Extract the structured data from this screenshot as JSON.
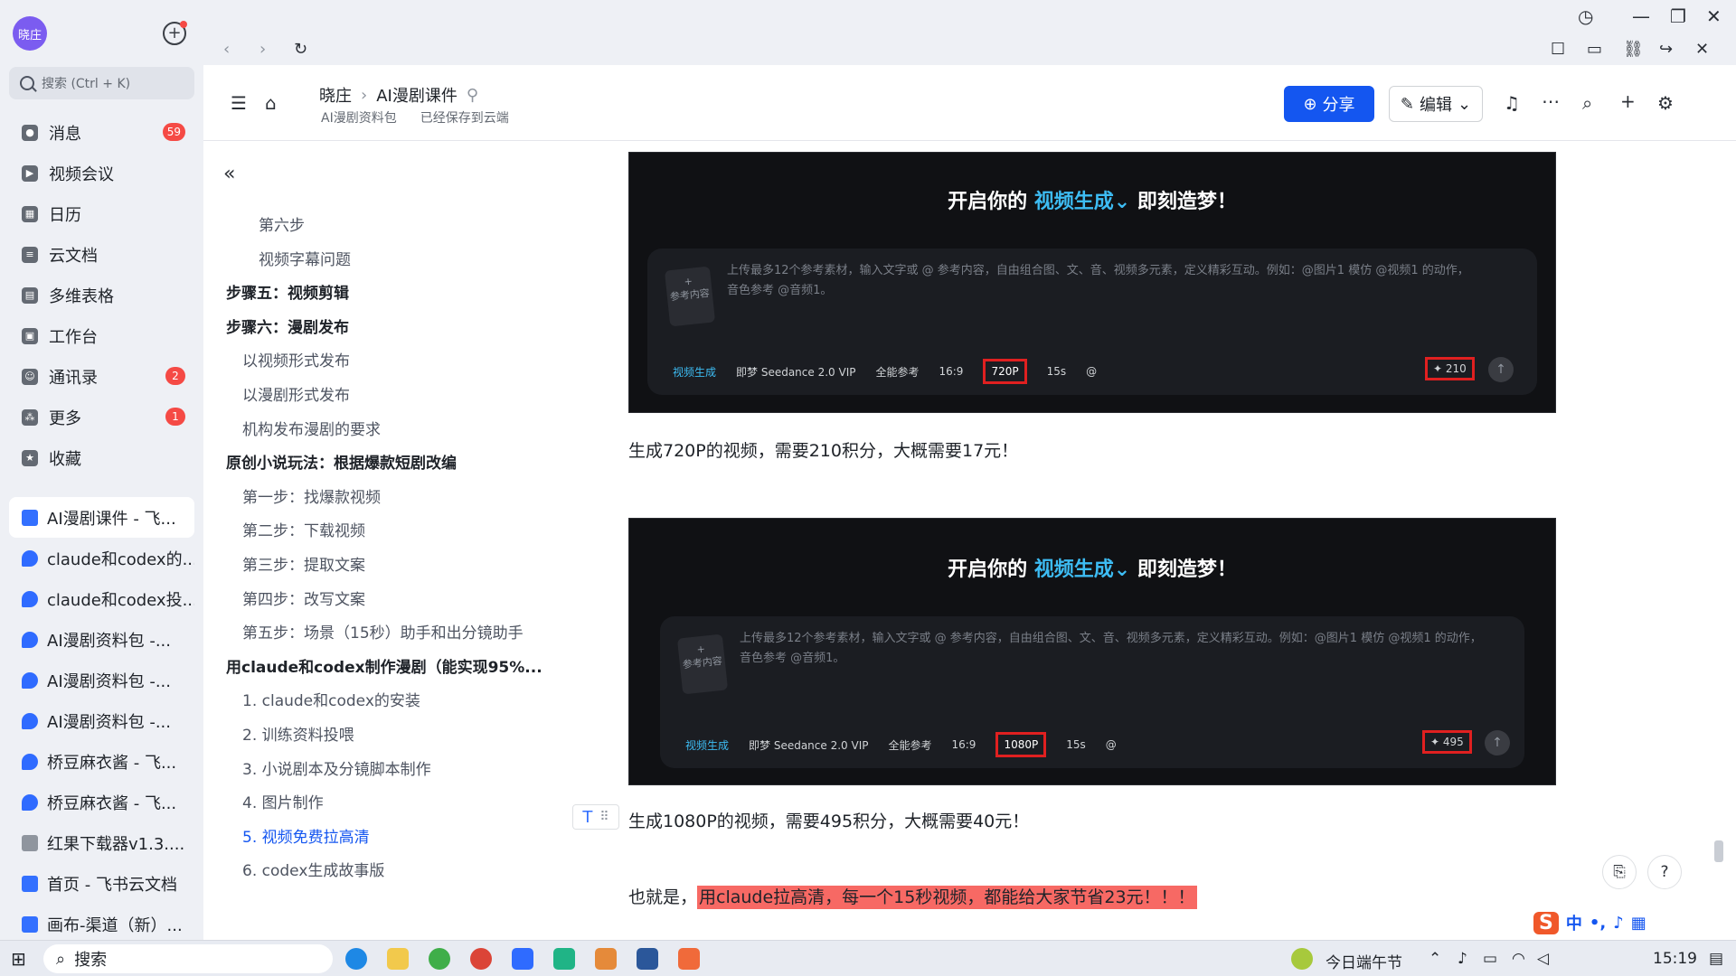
{
  "sidebar": {
    "avatar": "晓庄",
    "search_placeholder": "搜索 (Ctrl + K)",
    "nav": [
      {
        "label": "消息",
        "badge": "59"
      },
      {
        "label": "视频会议",
        "badge": ""
      },
      {
        "label": "日历",
        "badge": ""
      },
      {
        "label": "云文档",
        "badge": ""
      },
      {
        "label": "多维表格",
        "badge": ""
      },
      {
        "label": "工作台",
        "badge": ""
      },
      {
        "label": "通讯录",
        "badge": "2"
      },
      {
        "label": "更多",
        "badge": "1"
      },
      {
        "label": "收藏",
        "badge": ""
      }
    ],
    "recent": [
      {
        "label": "AI漫剧课件 - 飞...",
        "icon": "doc"
      },
      {
        "label": "claude和codex的...",
        "icon": "bird"
      },
      {
        "label": "claude和codex投...",
        "icon": "bird"
      },
      {
        "label": "AI漫剧资料包 -...",
        "icon": "bird"
      },
      {
        "label": "AI漫剧资料包 -...",
        "icon": "bird"
      },
      {
        "label": "AI漫剧资料包 -...",
        "icon": "bird"
      },
      {
        "label": "桥豆麻衣酱 - 飞...",
        "icon": "bird"
      },
      {
        "label": "桥豆麻衣酱 - 飞...",
        "icon": "bird"
      },
      {
        "label": "红果下载器v1.3....",
        "icon": "file"
      },
      {
        "label": "首页 - 飞书云文档",
        "icon": "doc"
      },
      {
        "label": "画布-渠道（新）...",
        "icon": "doc"
      }
    ]
  },
  "header": {
    "crumb_root": "晓庄",
    "crumb_doc": "AI漫剧课件",
    "sub_folder": "AI漫剧资料包",
    "save_status": "已经保存到云端",
    "share": "分享",
    "edit": "编辑"
  },
  "toc": {
    "items": [
      {
        "label": "第六步",
        "level": 2
      },
      {
        "label": "视频字幕问题",
        "level": 2
      },
      {
        "label": "步骤五：视频剪辑",
        "level": 0
      },
      {
        "label": "步骤六：漫剧发布",
        "level": 0
      },
      {
        "label": "以视频形式发布",
        "level": 1
      },
      {
        "label": "以漫剧形式发布",
        "level": 1
      },
      {
        "label": "机构发布漫剧的要求",
        "level": 1
      },
      {
        "label": "原创小说玩法：根据爆款短剧改编",
        "level": 0
      },
      {
        "label": "第一步：找爆款视频",
        "level": 1
      },
      {
        "label": "第二步：下载视频",
        "level": 1
      },
      {
        "label": "第三步：提取文案",
        "level": 1
      },
      {
        "label": "第四步：改写文案",
        "level": 1
      },
      {
        "label": "第五步：场景（15秒）助手和出分镜助手",
        "level": 1
      },
      {
        "label": "用claude和codex制作漫剧（能实现95%...",
        "level": 0
      },
      {
        "label": "1. claude和codex的安装",
        "level": 1
      },
      {
        "label": "2. 训练资料投喂",
        "level": 1
      },
      {
        "label": "3. 小说剧本及分镜脚本制作",
        "level": 1
      },
      {
        "label": "4. 图片制作",
        "level": 1
      },
      {
        "label": "5. 视频免费拉高清",
        "level": 1,
        "active": true
      },
      {
        "label": "6. codex生成故事版",
        "level": 1
      }
    ]
  },
  "shot1": {
    "title_pre": "开启你的",
    "title_hl": "视频生成",
    "title_post": "即刻造梦！",
    "upload": "参考内容",
    "hint1": "上传最多12个参考素材，输入文字或 @ 参考内容，自由组合图、文、音、视频多元素，定义精彩互动。例如：@图片1 模仿 @视频1 的动作，",
    "hint2": "音色参考 @音频1。",
    "mode": "视频生成",
    "model": "即梦 Seedance 2.0 VIP",
    "ref": "全能参考",
    "ratio": "16:9",
    "res": "720P",
    "dur": "15s",
    "at": "@",
    "points": "210"
  },
  "para1": "生成720P的视频，需要210积分，大概需要17元！",
  "shot2": {
    "title_pre": "开启你的",
    "title_hl": "视频生成",
    "title_post": "即刻造梦！",
    "upload": "参考内容",
    "hint1": "上传最多12个参考素材，输入文字或 @ 参考内容，自由组合图、文、音、视频多元素，定义精彩互动。例如：@图片1 模仿 @视频1 的动作，",
    "hint2": "音色参考 @音频1。",
    "mode": "视频生成",
    "model": "即梦 Seedance 2.0 VIP",
    "ref": "全能参考",
    "ratio": "16:9",
    "res": "1080P",
    "dur": "15s",
    "at": "@",
    "points": "495"
  },
  "para2": "生成1080P的视频，需要495积分，大概需要40元！",
  "para3_pre": "也就是，",
  "para3_mark": "用claude拉高清，每一个15秒视频，都能给大家节省23元！！！",
  "taskbar": {
    "search": "搜索",
    "holiday": "今日端午节",
    "time": "15:19",
    "ime": "中"
  }
}
